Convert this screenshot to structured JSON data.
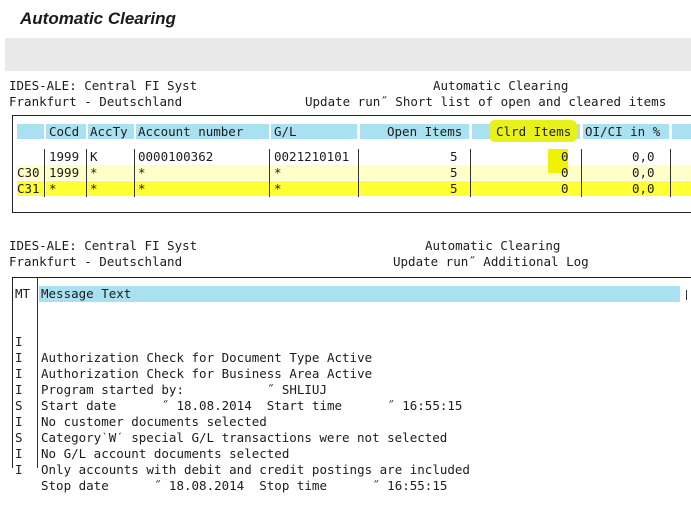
{
  "window": {
    "title": "Automatic Clearing"
  },
  "report1": {
    "left_line1": "IDES-ALE: Central FI Syst",
    "left_line2": "Frankfurt - Deutschland",
    "right_line1": "Automatic Clearing",
    "right_line2": "Update run˝ Short list of open and cleared items"
  },
  "table": {
    "headers": [
      "CoCd",
      "AccTy",
      "Account number",
      "G/L",
      "Open Items",
      "Clrd Items",
      "OI/CI in %"
    ],
    "rows": [
      {
        "mark": "",
        "cocd": "1999",
        "accty": "K",
        "account": "0000100362",
        "gl": "0021210101",
        "open": "5",
        "clrd": "0",
        "pct": "0,0"
      },
      {
        "mark": "C30",
        "cocd": "1999",
        "accty": "*",
        "account": "*",
        "gl": "*",
        "open": "5",
        "clrd": "0",
        "pct": "0,0"
      },
      {
        "mark": "C31",
        "cocd": "*",
        "accty": "*",
        "account": "*",
        "gl": "*",
        "open": "5",
        "clrd": "0",
        "pct": "0,0"
      }
    ]
  },
  "report2": {
    "left_line1": "IDES-ALE: Central FI Syst",
    "left_line2": "Frankfurt - Deutschland",
    "right_line1": "Automatic Clearing",
    "right_line2": "Update run˝ Additional Log"
  },
  "log": {
    "col_mt": "MT",
    "col_text": "Message Text",
    "lines": [
      {
        "mt": "I",
        "text": "Authorization Check for Document Type Active"
      },
      {
        "mt": "I",
        "text": "Authorization Check for Business Area Active"
      },
      {
        "mt": "I",
        "text": "Program started by:           ˝ SHLIUJ"
      },
      {
        "mt": "I",
        "text": "Start date      ˝ 18.08.2014  Start time      ˝ 16:55:15"
      },
      {
        "mt": "S",
        "text": "No customer documents selected"
      },
      {
        "mt": "I",
        "text": "CategoryˋWˊ special G/L transactions were not selected"
      },
      {
        "mt": "S",
        "text": "No G/L account documents selected"
      },
      {
        "mt": "I",
        "text": "Only accounts with debit and credit postings are included"
      },
      {
        "mt": "I",
        "text": "Stop date      ˝ 18.08.2014  Stop time      ˝ 16:55:15"
      }
    ]
  },
  "colors": {
    "header_blue": "#a9e1f1",
    "highlight_yellow": "#ffff33",
    "light_yellow": "#ffffc8",
    "marker_yellow": "#f2f200"
  }
}
